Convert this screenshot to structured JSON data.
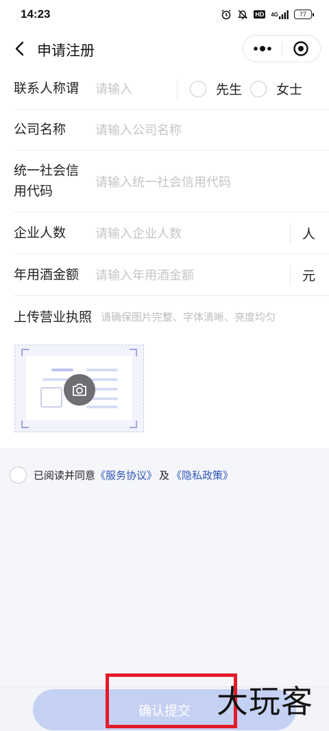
{
  "status_bar": {
    "time": "14:23",
    "hd_label": "HD",
    "network_label": "4G",
    "battery": "77"
  },
  "nav": {
    "title": "申请注册"
  },
  "form": {
    "contact": {
      "label": "联系人称谓",
      "placeholder": "请输入",
      "options": [
        "先生",
        "女士"
      ]
    },
    "company": {
      "label": "公司名称",
      "placeholder": "请输入公司名称"
    },
    "credit_code": {
      "label_line1": "统一社会信",
      "label_line2": "用代码",
      "placeholder": "请输入统一社会信用代码"
    },
    "staff": {
      "label": "企业人数",
      "placeholder": "请输入企业人数",
      "unit": "人"
    },
    "liquor": {
      "label": "年用酒金额",
      "placeholder": "请输入年用酒金额",
      "unit": "元"
    },
    "license": {
      "label": "上传营业执照",
      "hint": "请确保图片完整、字体清晰、亮度均匀"
    }
  },
  "agreement": {
    "prefix": "已阅读并同意",
    "service_link": "《服务协议》",
    "joiner": "及",
    "privacy_link": "《隐私政策》"
  },
  "submit_label": "确认提交",
  "watermark": "大玩客",
  "colors": {
    "link": "#2f55b8",
    "button_disabled": "#c5d1f3",
    "placeholder": "#c5c5c5",
    "highlight_frame": "#e31b2a"
  }
}
